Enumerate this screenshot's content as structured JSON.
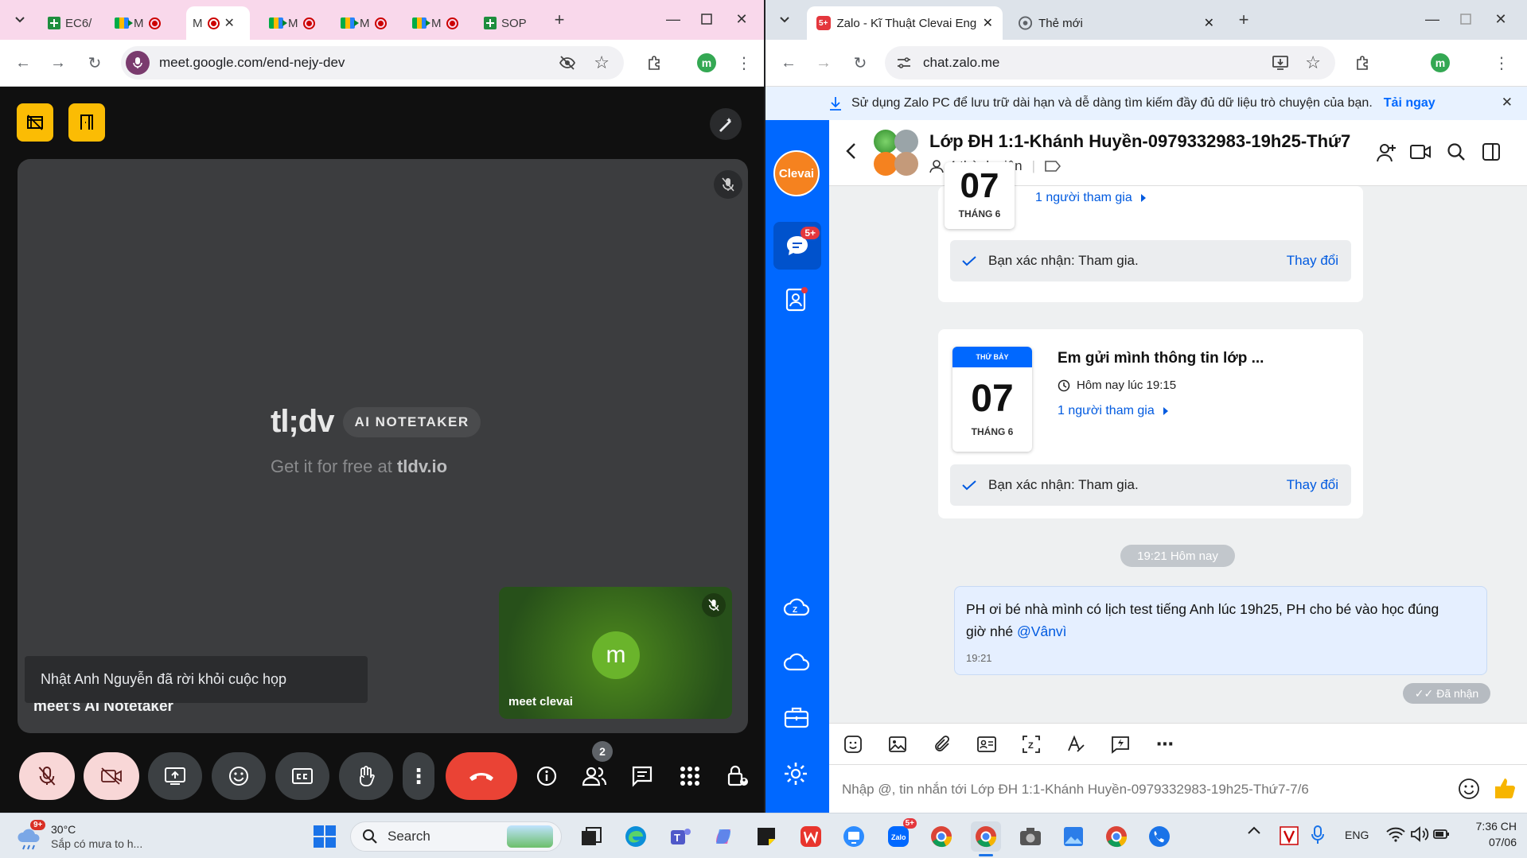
{
  "left_window": {
    "tabs": [
      {
        "label": "EC6/",
        "icon": "sheets-icon"
      },
      {
        "label": "M",
        "icon": "meet-icon",
        "recording": true
      },
      {
        "label": "M",
        "icon": "meet-icon",
        "recording": true,
        "active": true
      },
      {
        "label": "M",
        "icon": "meet-icon",
        "recording": true
      },
      {
        "label": "M",
        "icon": "meet-icon",
        "recording": true
      },
      {
        "label": "M",
        "icon": "meet-icon",
        "recording": true
      },
      {
        "label": "SOP",
        "icon": "sheets-icon"
      }
    ],
    "url": "meet.google.com/end-nejy-dev",
    "profile_initial": "m"
  },
  "meet": {
    "brand": "tl;dv",
    "badge": "AI NOTETAKER",
    "tagline_prefix": "Get it for free at ",
    "tagline_site": "tldv.io",
    "main_participant": "meet's AI Notetaker",
    "self_tile_name": "meet clevai",
    "self_initial": "m",
    "toast": "Nhật Anh Nguyễn đã rời khỏi cuộc họp",
    "participant_count": "2",
    "colors": {
      "accent_yellow": "#fbbc04",
      "end_call": "#ea4335",
      "mute_bg": "#f8d7d7"
    }
  },
  "right_window": {
    "tabs": [
      {
        "label": "Zalo - Kĩ Thuật Clevai English",
        "badge": "5+",
        "active": true
      },
      {
        "label": "Thẻ mới"
      }
    ],
    "url": "chat.zalo.me",
    "profile_initial": "m",
    "banner_text": "Sử dụng Zalo PC để lưu trữ dài hạn và dễ dàng tìm kiếm đầy đủ dữ liệu trò chuyện của bạn.",
    "banner_link": "Tải ngay"
  },
  "zalo": {
    "logo_text": "Clevai",
    "sidebar_badge": "5+",
    "chat_title": "Lớp ĐH 1:1-Khánh Huyền-0979332983-19h25-Thứ7",
    "member_count": "4 thành viên",
    "event1": {
      "day_number": "07",
      "month_label": "THÁNG 6",
      "attendees": "1 người tham gia",
      "confirm": "Bạn xác nhận: Tham gia.",
      "change": "Thay đổi"
    },
    "event2": {
      "weekday": "THỨ BẢY",
      "day_number": "07",
      "month_label": "THÁNG 6",
      "title": "Em gửi mình thông tin lớp ...",
      "time": "Hôm nay lúc 19:15",
      "attendees": "1 người tham gia",
      "confirm": "Bạn xác nhận: Tham gia.",
      "change": "Thay đổi"
    },
    "time_divider": "19:21 Hôm nay",
    "message": {
      "text": "PH ơi bé nhà mình có lịch test tiếng Anh lúc 19h25, PH cho bé vào học đúng giờ nhé ",
      "mention": "@Vânvì",
      "time": "19:21",
      "status": "Đã nhận"
    },
    "input_placeholder": "Nhập @, tin nhắn tới Lớp ĐH 1:1-Khánh Huyền-0979332983-19h25-Thứ7-7/6",
    "colors": {
      "brand": "#0068ff",
      "link": "#005ae0"
    }
  },
  "taskbar": {
    "weather_badge": "9+",
    "temperature": "30°C",
    "forecast": "Sắp có mưa to h...",
    "search_label": "Search",
    "zalo_badge": "5+",
    "language": "ENG",
    "clock_time": "7:36 CH",
    "clock_date": "07/06"
  }
}
